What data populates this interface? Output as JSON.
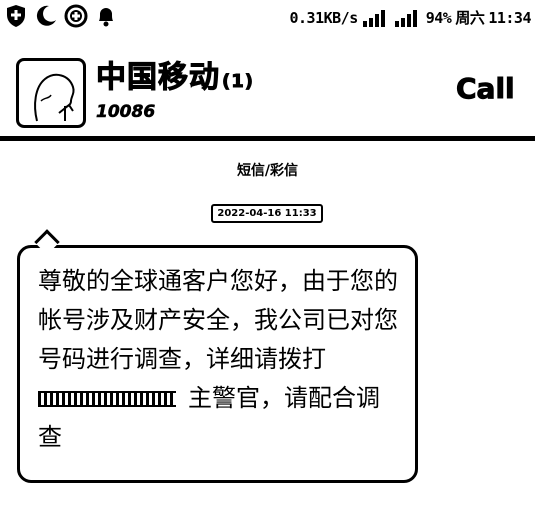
{
  "status_bar": {
    "left_icons": [
      "shield-icon",
      "moon-icon",
      "plus-circle-icon",
      "bell-icon"
    ],
    "network_speed": "0.31KB/s",
    "battery": "94%",
    "weekday": "周六",
    "time": "11:34"
  },
  "header": {
    "contact_name": "中国移动",
    "contact_count": "(1)",
    "contact_number": "10086",
    "call_label": "Call"
  },
  "conversation": {
    "type_label": "短信/彩信",
    "timestamp": "2022-04-16  11:33",
    "message": {
      "line1": "尊敬的全球通客户您好，由于您的",
      "line2": "帐号涉及财产安全，我公司已对您",
      "line3": "号码进行调查，详细请拨打",
      "line4_suffix": "主警官，请配合调",
      "line5": "查"
    }
  }
}
